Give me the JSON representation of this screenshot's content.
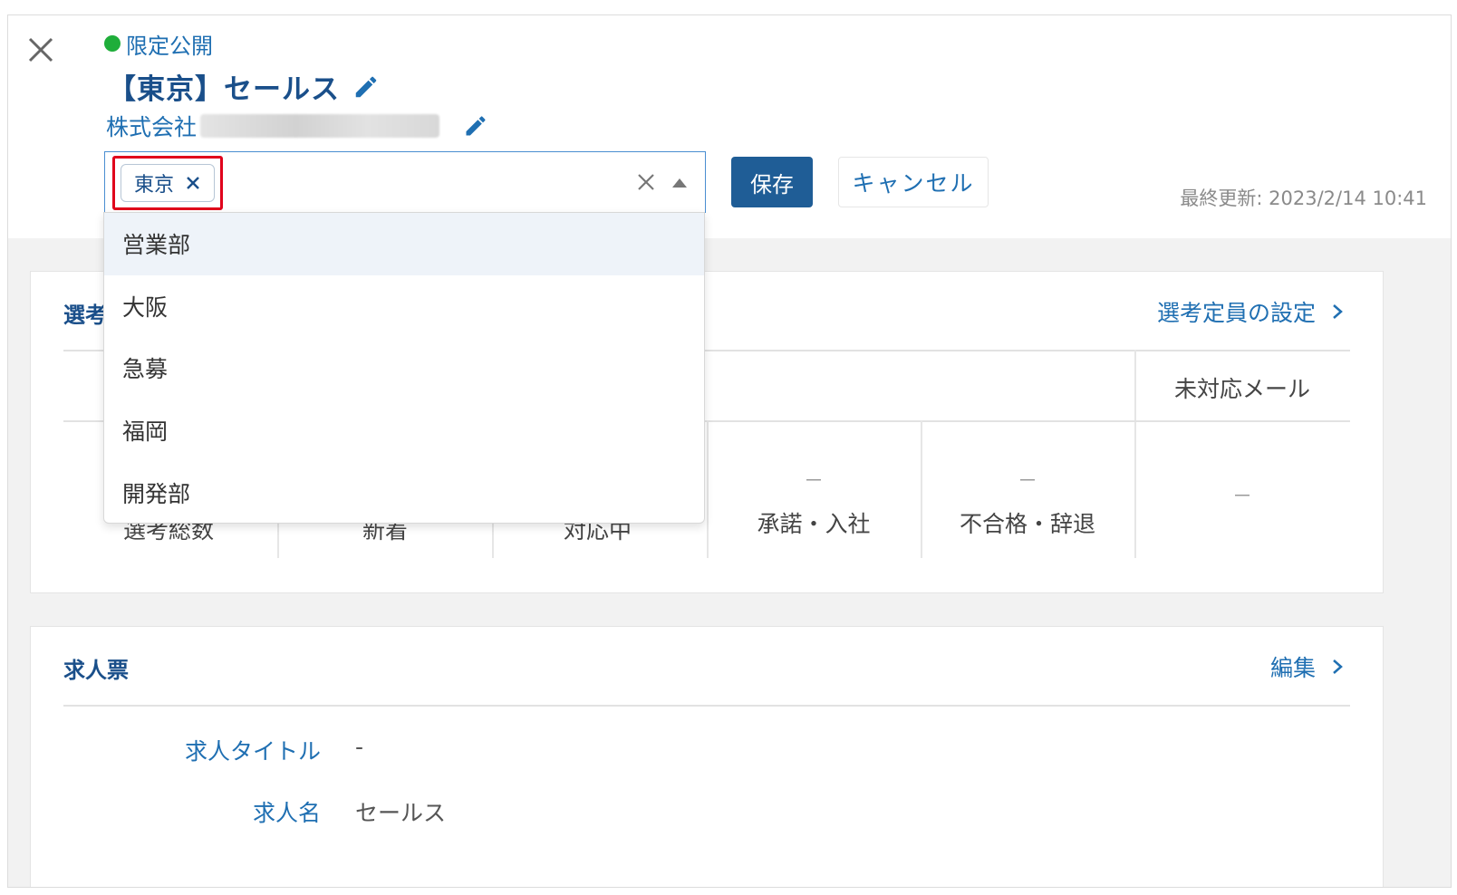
{
  "header": {
    "status": "限定公開",
    "status_color": "#1fae3a",
    "title": "【東京】セールス",
    "company_prefix": "株式会社",
    "tags": [
      "東京"
    ],
    "save_label": "保存",
    "cancel_label": "キャンセル",
    "last_updated": "最終更新: 2023/2/14 10:41"
  },
  "dropdown": {
    "options": [
      "営業部",
      "大阪",
      "急募",
      "福岡",
      "開発部"
    ],
    "active_index": 0
  },
  "selection_card": {
    "title_partial": "選考",
    "link_label": "選考定員の設定",
    "unhandled_mail_header": "未対応メール",
    "stats": [
      {
        "value": "－",
        "label": "承諾・入社"
      },
      {
        "value": "－",
        "label": "不合格・辞退"
      }
    ],
    "unhandled_mail_value": "－",
    "hidden_labels": [
      "選考総数",
      "新着",
      "対応中"
    ]
  },
  "job_card": {
    "title": "求人票",
    "link_label": "編集",
    "fields": [
      {
        "label": "求人タイトル",
        "value": "-"
      },
      {
        "label": "求人名",
        "value": "セールス"
      }
    ]
  },
  "colors": {
    "primary": "#1f5d96",
    "link": "#1f6fb2",
    "highlight": "#e0001b"
  }
}
